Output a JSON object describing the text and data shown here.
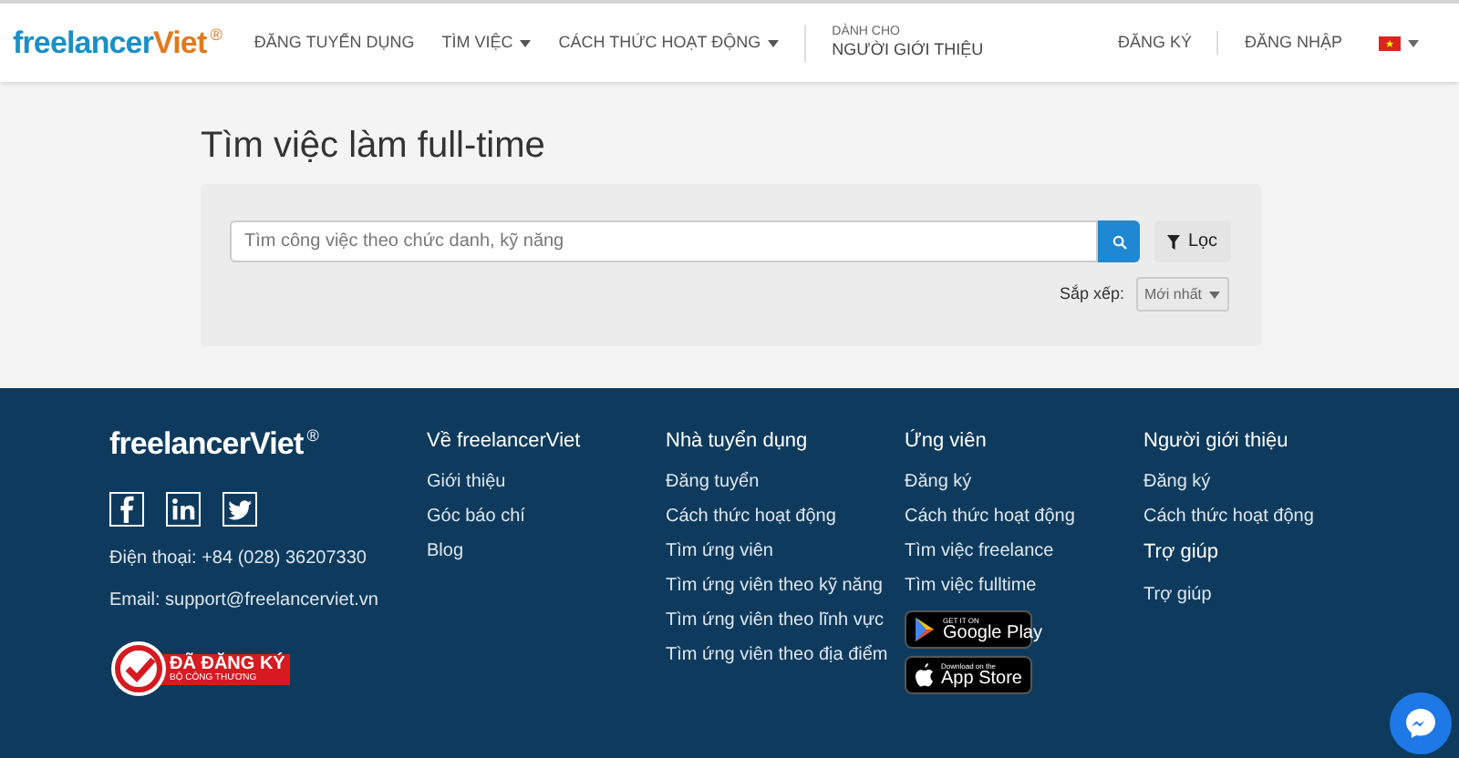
{
  "header": {
    "logo": {
      "main": "freelancer",
      "accent": "Viet",
      "mark": "®"
    },
    "nav": [
      {
        "label": "ĐĂNG TUYỂN DỤNG",
        "dropdown": false
      },
      {
        "label": "TÌM VIỆC",
        "dropdown": true
      },
      {
        "label": "CÁCH THỨC HOẠT ĐỘNG",
        "dropdown": true
      }
    ],
    "referrer": {
      "small": "DÀNH CHO",
      "label": "NGƯỜI GIỚI THIỆU"
    },
    "auth": [
      "ĐĂNG KÝ",
      "ĐĂNG NHẬP"
    ]
  },
  "search_page": {
    "title": "Tìm việc làm full-time",
    "search": {
      "placeholder": "Tìm công việc theo chức danh, kỹ năng"
    },
    "filter_button": "Lọc",
    "sort": {
      "label": "Sắp xếp:",
      "value": "Mới nhất"
    }
  },
  "footer": {
    "logo": {
      "main": "freelancer",
      "accent": "Viet",
      "mark": "®"
    },
    "social": [
      {
        "kind": "facebook"
      },
      {
        "kind": "linkedin"
      },
      {
        "kind": "twitter"
      }
    ],
    "phone": "Điện thoại: +84 (028) 36207330",
    "email": "Email: support@freelancerviet.vn",
    "registered_badge": {
      "title": "ĐÃ ĐĂNG KÝ",
      "subtitle": "BỘ CÔNG THƯƠNG"
    },
    "columns": [
      {
        "title": "Về freelancerViet",
        "links": [
          "Giới thiệu",
          "Góc báo chí",
          "Blog"
        ]
      },
      {
        "title": "Nhà tuyển dụng",
        "links": [
          "Đăng tuyển",
          "Cách thức hoạt động",
          "Tìm ứng viên",
          "Tìm ứng viên theo kỹ năng",
          "Tìm ứng viên theo lĩnh vực",
          "Tìm ứng viên theo địa điểm"
        ]
      },
      {
        "title": "Ứng viên",
        "links": [
          "Đăng ký",
          "Cách thức hoạt động",
          "Tìm việc freelance",
          "Tìm việc fulltime"
        ],
        "stores": [
          {
            "kind": "google",
            "small": "GET IT ON",
            "label": "Google Play"
          },
          {
            "kind": "apple",
            "small": "Download on the",
            "label": "App Store"
          }
        ]
      },
      {
        "title": "Người giới thiệu",
        "links": [
          "Đăng ký",
          "Cách thức hoạt động"
        ],
        "subsection": {
          "title": "Trợ giúp",
          "links": [
            "Trợ giúp"
          ]
        }
      }
    ]
  }
}
